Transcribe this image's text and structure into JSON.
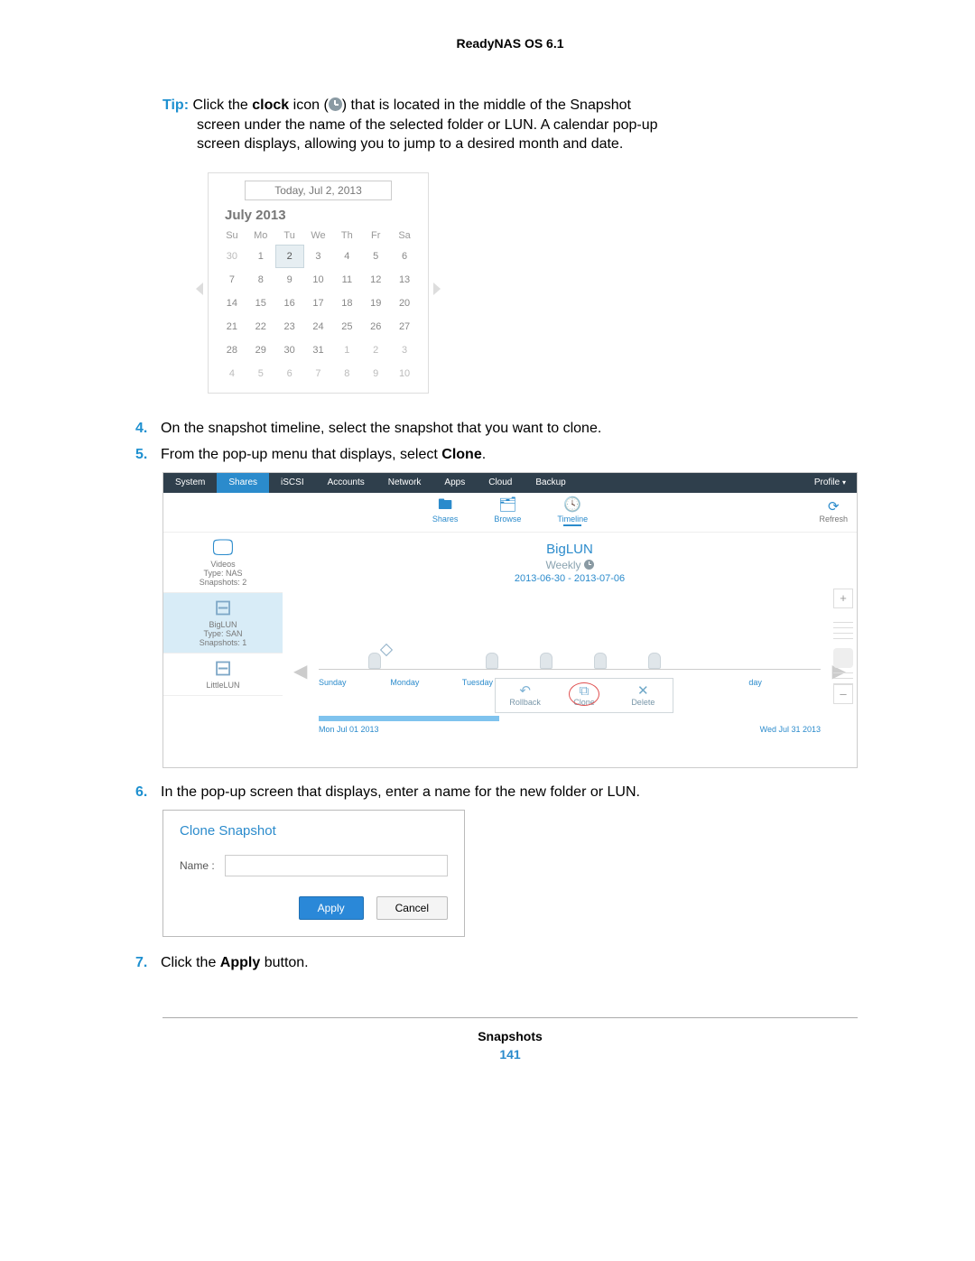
{
  "header": {
    "title": "ReadyNAS OS 6.1"
  },
  "tip": {
    "label": "Tip:",
    "line1a": " Click the ",
    "line1b": "clock",
    "line1c": " icon (",
    "line1d": ") that is located in the middle of the Snapshot",
    "line2": "screen under the name of the selected folder or LUN. A calendar pop-up",
    "line3": "screen displays, allowing you to jump to a desired month and date."
  },
  "calendar": {
    "today_label": "Today, Jul 2, 2013",
    "month_year": "July 2013",
    "dow": [
      "Su",
      "Mo",
      "Tu",
      "We",
      "Th",
      "Fr",
      "Sa"
    ],
    "days": [
      {
        "n": "30",
        "adj": true
      },
      {
        "n": "1"
      },
      {
        "n": "2",
        "sel": true
      },
      {
        "n": "3"
      },
      {
        "n": "4"
      },
      {
        "n": "5"
      },
      {
        "n": "6"
      },
      {
        "n": "7"
      },
      {
        "n": "8"
      },
      {
        "n": "9"
      },
      {
        "n": "10"
      },
      {
        "n": "11"
      },
      {
        "n": "12"
      },
      {
        "n": "13"
      },
      {
        "n": "14"
      },
      {
        "n": "15"
      },
      {
        "n": "16"
      },
      {
        "n": "17"
      },
      {
        "n": "18"
      },
      {
        "n": "19"
      },
      {
        "n": "20"
      },
      {
        "n": "21"
      },
      {
        "n": "22"
      },
      {
        "n": "23"
      },
      {
        "n": "24"
      },
      {
        "n": "25"
      },
      {
        "n": "26"
      },
      {
        "n": "27"
      },
      {
        "n": "28"
      },
      {
        "n": "29"
      },
      {
        "n": "30"
      },
      {
        "n": "31"
      },
      {
        "n": "1",
        "adj": true
      },
      {
        "n": "2",
        "adj": true
      },
      {
        "n": "3",
        "adj": true
      },
      {
        "n": "4",
        "adj": true
      },
      {
        "n": "5",
        "adj": true
      },
      {
        "n": "6",
        "adj": true
      },
      {
        "n": "7",
        "adj": true
      },
      {
        "n": "8",
        "adj": true
      },
      {
        "n": "9",
        "adj": true
      },
      {
        "n": "10",
        "adj": true
      }
    ]
  },
  "steps": {
    "s4": {
      "num": "4.",
      "text": "On the snapshot timeline, select the snapshot that you want to clone."
    },
    "s5": {
      "num": "5.",
      "text_a": "From the pop-up menu that displays, select ",
      "bold": "Clone",
      "text_b": "."
    },
    "s6": {
      "num": "6.",
      "text": "In the pop-up screen that displays, enter a name for the new folder or LUN."
    },
    "s7": {
      "num": "7.",
      "text_a": "Click the ",
      "bold": "Apply",
      "text_b": " button."
    }
  },
  "app": {
    "nav": [
      "System",
      "Shares",
      "iSCSI",
      "Accounts",
      "Network",
      "Apps",
      "Cloud",
      "Backup"
    ],
    "nav_active_index": 1,
    "profile": "Profile",
    "toolbar": {
      "shares": "Shares",
      "browse": "Browse",
      "timeline": "Timeline",
      "refresh": "Refresh"
    },
    "sidebar": [
      {
        "name": "Videos",
        "type": "Type: NAS",
        "snap": "Snapshots: 2",
        "icon": "monitor"
      },
      {
        "name": "BigLUN",
        "type": "Type: SAN",
        "snap": "Snapshots: 1",
        "icon": "drive",
        "selected": true
      },
      {
        "name": "LittleLUN",
        "type": "",
        "snap": "",
        "icon": "drive"
      }
    ],
    "main": {
      "title": "BigLUN",
      "sub": "Weekly",
      "daterange": "2013-06-30 - 2013-07-06",
      "days": [
        "Sunday",
        "Monday",
        "Tuesday",
        "",
        "",
        "",
        "day"
      ],
      "start": "Mon Jul 01 2013",
      "end": "Wed Jul 31 2013"
    },
    "popup": {
      "rollback": "Rollback",
      "clone": "Clone",
      "delete": "Delete"
    },
    "plus": "+",
    "minus": "–"
  },
  "dialog": {
    "title": "Clone Snapshot",
    "name_label": "Name :",
    "apply": "Apply",
    "cancel": "Cancel"
  },
  "footer": {
    "section": "Snapshots",
    "page": "141"
  }
}
